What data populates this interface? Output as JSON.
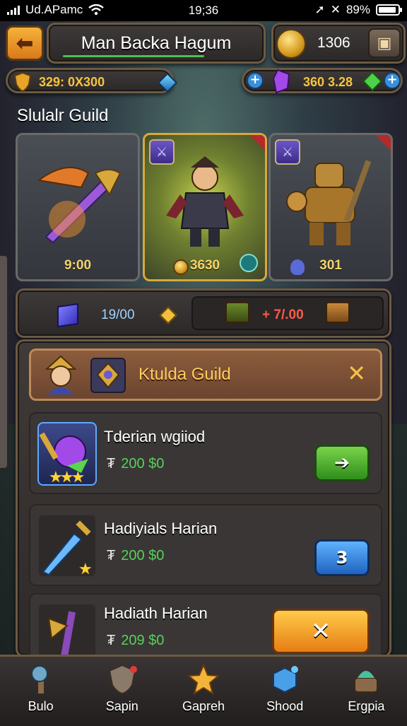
{
  "status_bar": {
    "carrier": "Ud.APamc",
    "time": "19;36",
    "battery": "89%"
  },
  "header": {
    "title": "Man Backa Hagum",
    "gold": "1306"
  },
  "resources": {
    "left_value": "329: 0X300",
    "right_value": "360 3.28"
  },
  "section": {
    "title": "Slulalr Guild"
  },
  "heroes": [
    {
      "value": "9:00"
    },
    {
      "value": "3630"
    },
    {
      "value": "301"
    }
  ],
  "mid_panel": {
    "left_value": "19/00",
    "right_value": "+ 7/.00"
  },
  "guild": {
    "name": "Ktulda Guild",
    "items": [
      {
        "name": "Tderian wgiiod",
        "currency": "₮",
        "price": "200 $0",
        "stars": "★★★"
      },
      {
        "name": "Hadiyials Harian",
        "currency": "₮",
        "price": "200 $0",
        "action": "3",
        "stars": "★"
      },
      {
        "name": "Hadiath Harian",
        "currency": "₮",
        "price": "209 $0"
      }
    ]
  },
  "nav": [
    {
      "label": "Bulo"
    },
    {
      "label": "Sapin"
    },
    {
      "label": "Gapreh"
    },
    {
      "label": "Shood"
    },
    {
      "label": "Ergpia"
    }
  ],
  "colors": {
    "gold_text": "#f7c53d",
    "green_price": "#58d05a",
    "red_value": "#ff5a4a"
  }
}
